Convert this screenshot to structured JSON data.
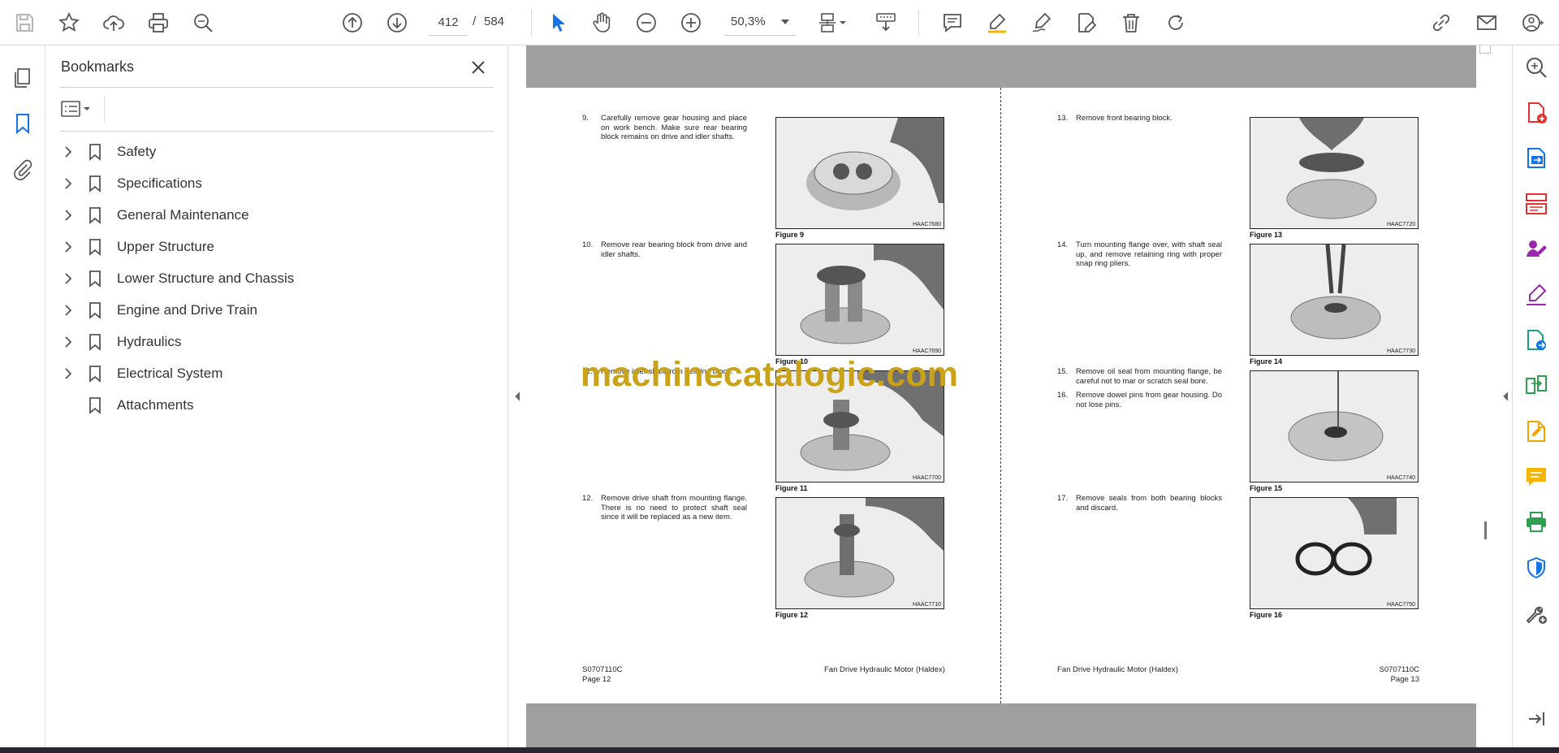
{
  "toolbar": {
    "page_current": "412",
    "page_separator": "/",
    "page_total": "584",
    "zoom": "50,3%"
  },
  "bookmarks": {
    "title": "Bookmarks",
    "items": [
      {
        "label": "Safety",
        "expandable": true
      },
      {
        "label": "Specifications",
        "expandable": true
      },
      {
        "label": "General Maintenance",
        "expandable": true
      },
      {
        "label": "Upper Structure",
        "expandable": true
      },
      {
        "label": "Lower Structure and Chassis",
        "expandable": true
      },
      {
        "label": "Engine and Drive Train",
        "expandable": true
      },
      {
        "label": "Hydraulics",
        "expandable": true
      },
      {
        "label": "Electrical System",
        "expandable": true
      },
      {
        "label": "Attachments",
        "expandable": false
      }
    ]
  },
  "document": {
    "left_page": {
      "steps": [
        {
          "num": "9.",
          "text": "Carefully remove gear housing and place on work bench. Make sure rear bearing block remains on drive and idler shafts."
        },
        {
          "num": "10.",
          "text": "Remove rear bearing block from drive and idler shafts."
        },
        {
          "num": "11.",
          "text": "Remove idler shaft from bearing block."
        },
        {
          "num": "12.",
          "text": "Remove drive shaft from mounting flange. There is no need to protect shaft seal since it will be replaced as a new item."
        }
      ],
      "figures": [
        {
          "caption": "Figure 9",
          "code": "HAAC7680"
        },
        {
          "caption": "Figure 10",
          "code": "HAAC7690"
        },
        {
          "caption": "Figure 11",
          "code": "HAAC7700"
        },
        {
          "caption": "Figure 12",
          "code": "HAAC7710"
        }
      ],
      "footer_code": "S0707110C",
      "footer_page": "Page 12",
      "footer_title": "Fan Drive Hydraulic Motor (Haldex)"
    },
    "right_page": {
      "steps": [
        {
          "num": "13.",
          "text": "Remove front bearing block."
        },
        {
          "num": "14.",
          "text": "Turn mounting flange over, with shaft seal up, and remove retaining ring with proper snap ring pliers."
        },
        {
          "num": "15.",
          "text": "Remove oil seal from mounting flange, be careful not to mar or scratch seal bore."
        },
        {
          "num": "16.",
          "text": "Remove dowel pins from gear housing. Do not lose pins."
        },
        {
          "num": "17.",
          "text": "Remove seals from both bearing blocks and discard."
        }
      ],
      "figures": [
        {
          "caption": "Figure 13",
          "code": "HAAC7720"
        },
        {
          "caption": "Figure 14",
          "code": "HAAC7730"
        },
        {
          "caption": "Figure 15",
          "code": "HAAC7740"
        },
        {
          "caption": "Figure 16",
          "code": "HAAC7750"
        }
      ],
      "footer_title": "Fan Drive Hydraulic Motor (Haldex)",
      "footer_code": "S0707110C",
      "footer_page": "Page 13"
    },
    "watermark": "machinecatalogic.com"
  },
  "colors": {
    "accent_blue": "#1473e6",
    "watermark": "#c9a21a",
    "page_background": "#9f9f9f"
  }
}
